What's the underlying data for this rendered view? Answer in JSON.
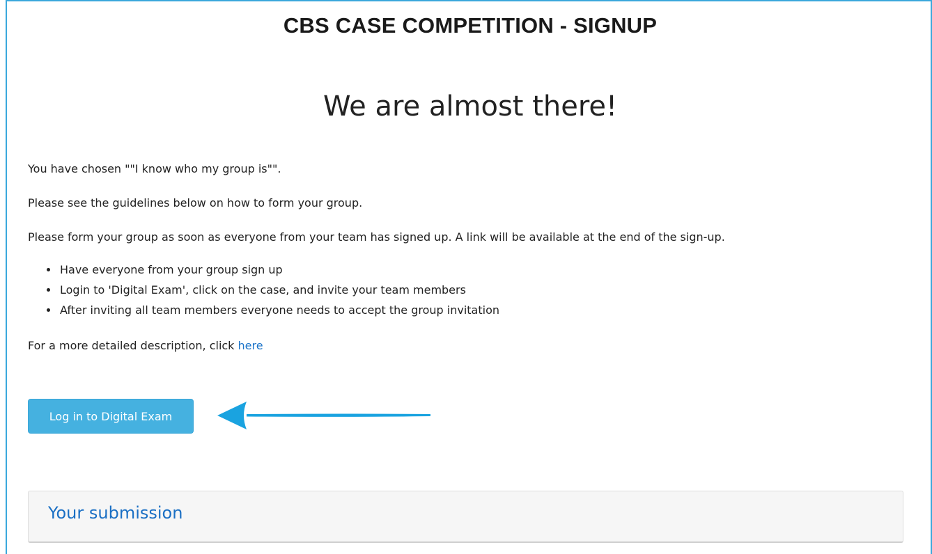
{
  "header": {
    "title": "CBS CASE COMPETITION - SIGNUP"
  },
  "main": {
    "heading": "We are almost there!",
    "choice_text": "You have chosen \"\"I know who my group is\"\".",
    "guidelines_text": "Please see the guidelines below on how to form your group.",
    "instruction_text": "Please form your group as soon as everyone from your team has signed up. A link will be available at the end of the sign-up.",
    "steps": [
      "Have everyone from your group sign up",
      "Login to 'Digital Exam', click on the case, and invite your team members",
      "After inviting all team members everyone needs to accept the group invitation"
    ],
    "detail_prefix": "For a more detailed description, click ",
    "detail_link": "here",
    "login_button": "Log in to Digital Exam"
  },
  "submission": {
    "title": "Your submission"
  },
  "colors": {
    "accent": "#45b1e0",
    "link": "#1a73c8",
    "arrow": "#1aa3e0",
    "frame": "#3aa8dc"
  },
  "icons": {
    "arrow": "left-arrow-icon"
  }
}
